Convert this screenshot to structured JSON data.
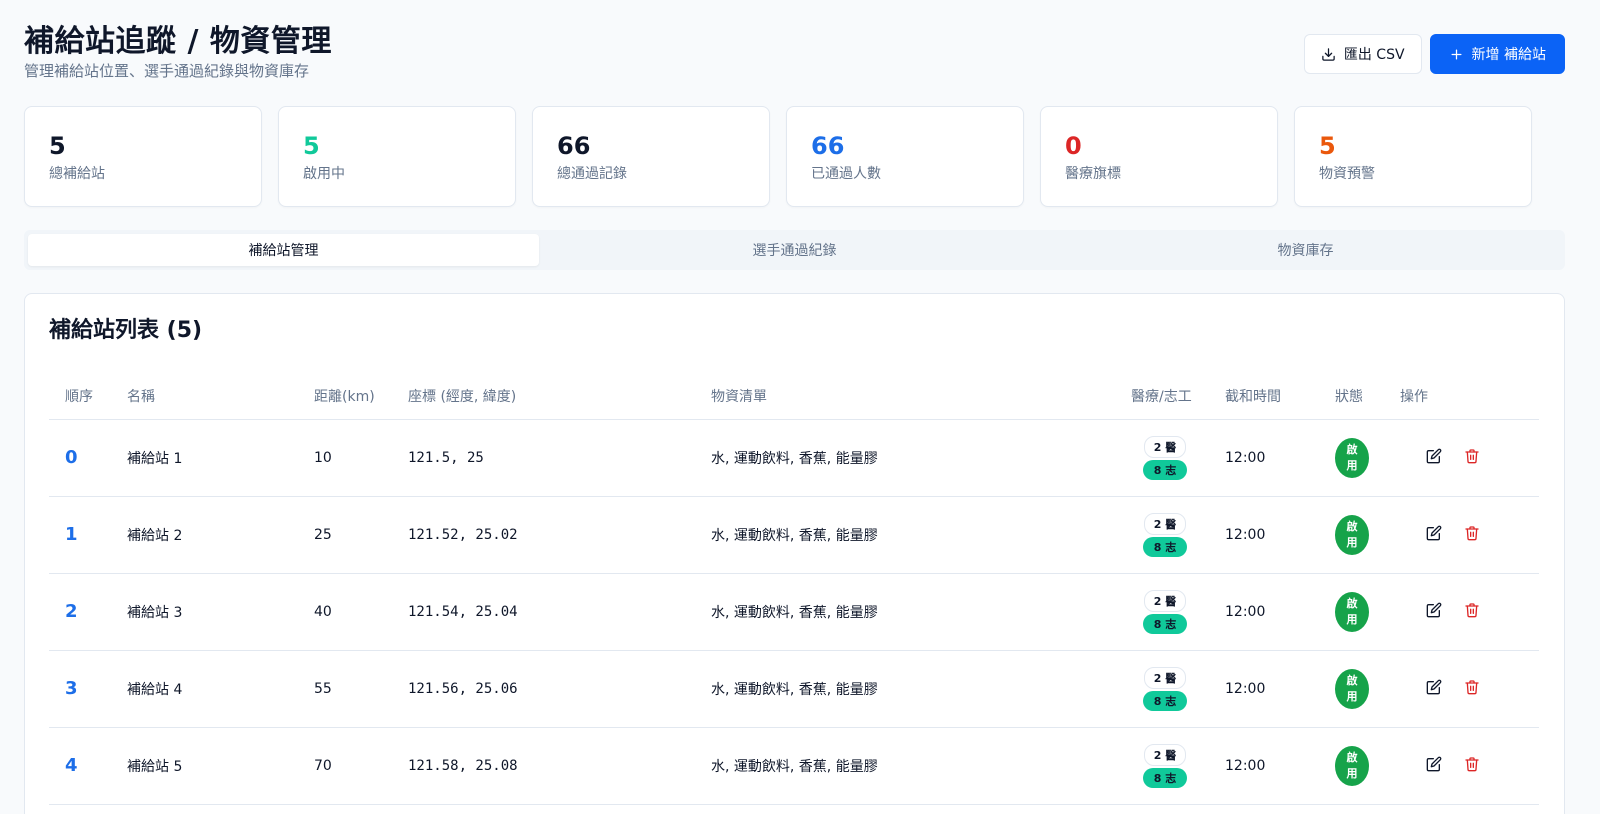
{
  "header": {
    "title": "補給站追蹤 / 物資管理",
    "subtitle": "管理補給站位置、選手通過紀錄與物資庫存",
    "export_label": "匯出 CSV",
    "add_label": "新增 補給站"
  },
  "stats": [
    {
      "value": "5",
      "label": "總補給站",
      "color": "#0f172a"
    },
    {
      "value": "5",
      "label": "啟用中",
      "color": "#10c99a"
    },
    {
      "value": "66",
      "label": "總通過記錄",
      "color": "#0f172a"
    },
    {
      "value": "66",
      "label": "已通過人數",
      "color": "#1d6ee8"
    },
    {
      "value": "0",
      "label": "醫療旗標",
      "color": "#dc2626"
    },
    {
      "value": "5",
      "label": "物資預警",
      "color": "#ea580c"
    }
  ],
  "tabs": [
    "補給站管理",
    "選手通過紀錄",
    "物資庫存"
  ],
  "table": {
    "title": "補給站列表 (5)",
    "headers": [
      "順序",
      "名稱",
      "距離(km)",
      "座標 (經度, 緯度)",
      "物資清單",
      "醫療/志工",
      "截和時間",
      "狀態",
      "操作"
    ],
    "rows": [
      {
        "order": "0",
        "name": "補給站 1",
        "distance": "10",
        "coords": "121.5, 25",
        "supplies": "水, 運動飲料, 香蕉, 能量膠",
        "medical": "2 醫",
        "volunteers": "8 志",
        "cutoff": "12:00",
        "status": "啟用"
      },
      {
        "order": "1",
        "name": "補給站 2",
        "distance": "25",
        "coords": "121.52, 25.02",
        "supplies": "水, 運動飲料, 香蕉, 能量膠",
        "medical": "2 醫",
        "volunteers": "8 志",
        "cutoff": "12:00",
        "status": "啟用"
      },
      {
        "order": "2",
        "name": "補給站 3",
        "distance": "40",
        "coords": "121.54, 25.04",
        "supplies": "水, 運動飲料, 香蕉, 能量膠",
        "medical": "2 醫",
        "volunteers": "8 志",
        "cutoff": "12:00",
        "status": "啟用"
      },
      {
        "order": "3",
        "name": "補給站 4",
        "distance": "55",
        "coords": "121.56, 25.06",
        "supplies": "水, 運動飲料, 香蕉, 能量膠",
        "medical": "2 醫",
        "volunteers": "8 志",
        "cutoff": "12:00",
        "status": "啟用"
      },
      {
        "order": "4",
        "name": "補給站 5",
        "distance": "70",
        "coords": "121.58, 25.08",
        "supplies": "水, 運動飲料, 香蕉, 能量膠",
        "medical": "2 醫",
        "volunteers": "8 志",
        "cutoff": "12:00",
        "status": "啟用"
      }
    ]
  },
  "colors": {
    "primary": "#0b63f6",
    "status_active": "#16a34a",
    "volunteer_badge": "#10c99a",
    "delete": "#dc2626"
  },
  "icons": {
    "export": "download-icon",
    "add": "plus-icon",
    "edit": "edit-icon",
    "delete": "trash-icon"
  }
}
